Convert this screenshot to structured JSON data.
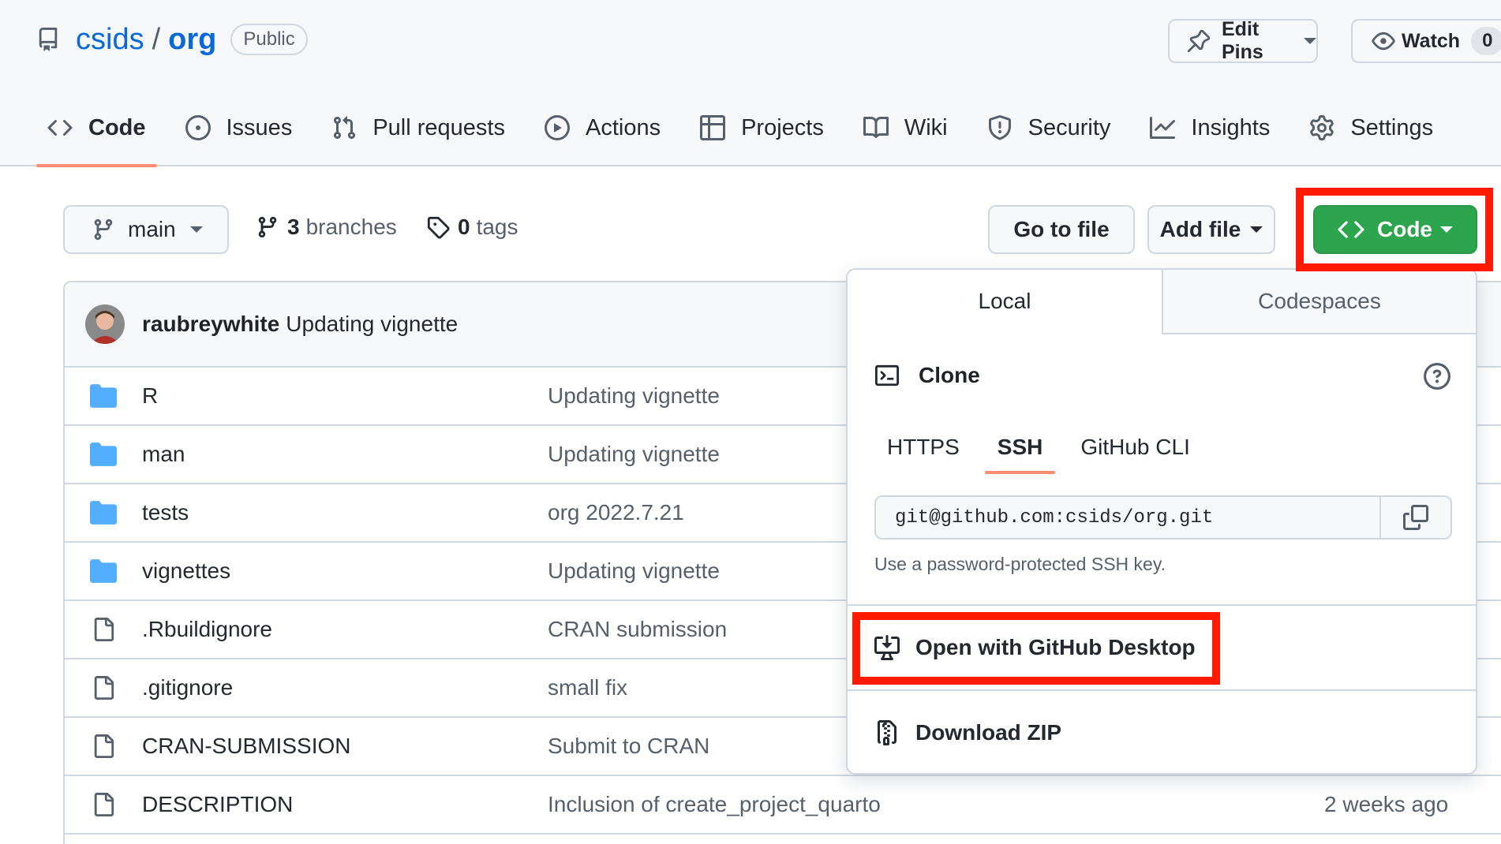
{
  "repo": {
    "owner": "csids",
    "separator": "/",
    "name": "org",
    "visibility": "Public"
  },
  "header_buttons": {
    "edit_pins": "Edit Pins",
    "watch": "Watch",
    "watch_count": "0"
  },
  "nav": {
    "items": [
      {
        "label": "Code",
        "icon": "code-icon"
      },
      {
        "label": "Issues",
        "icon": "issue-icon"
      },
      {
        "label": "Pull requests",
        "icon": "pull-request-icon"
      },
      {
        "label": "Actions",
        "icon": "play-icon"
      },
      {
        "label": "Projects",
        "icon": "table-icon"
      },
      {
        "label": "Wiki",
        "icon": "book-icon"
      },
      {
        "label": "Security",
        "icon": "shield-icon"
      },
      {
        "label": "Insights",
        "icon": "graph-icon"
      },
      {
        "label": "Settings",
        "icon": "gear-icon"
      }
    ]
  },
  "toolbar": {
    "branch": "main",
    "branches_count": "3",
    "branches_label": "branches",
    "tags_count": "0",
    "tags_label": "tags",
    "go_to_file": "Go to file",
    "add_file": "Add file",
    "code": "Code"
  },
  "latest_commit": {
    "author": "raubreywhite",
    "message": "Updating vignette"
  },
  "files": [
    {
      "type": "dir",
      "name": "R",
      "message": "Updating vignette",
      "age": ""
    },
    {
      "type": "dir",
      "name": "man",
      "message": "Updating vignette",
      "age": ""
    },
    {
      "type": "dir",
      "name": "tests",
      "message": "org 2022.7.21",
      "age": ""
    },
    {
      "type": "dir",
      "name": "vignettes",
      "message": "Updating vignette",
      "age": ""
    },
    {
      "type": "file",
      "name": ".Rbuildignore",
      "message": "CRAN submission",
      "age": ""
    },
    {
      "type": "file",
      "name": ".gitignore",
      "message": "small fix",
      "age": ""
    },
    {
      "type": "file",
      "name": "CRAN-SUBMISSION",
      "message": "Submit to CRAN",
      "age": ""
    },
    {
      "type": "file",
      "name": "DESCRIPTION",
      "message": "Inclusion of create_project_quarto",
      "age": "2 weeks ago"
    }
  ],
  "code_dropdown": {
    "tabs": {
      "local": "Local",
      "codespaces": "Codespaces"
    },
    "clone_title": "Clone",
    "protocols": [
      "HTTPS",
      "SSH",
      "GitHub CLI"
    ],
    "selected_protocol": "SSH",
    "url": "git@github.com:csids/org.git",
    "hint": "Use a password-protected SSH key.",
    "open_desktop": "Open with GitHub Desktop",
    "download_zip": "Download ZIP"
  },
  "colors": {
    "primary_green": "#2da44e",
    "link_blue": "#0969da",
    "tab_underline": "#fd8c73",
    "annotation_red": "#ff1a00",
    "folder_blue": "#54aeff"
  }
}
